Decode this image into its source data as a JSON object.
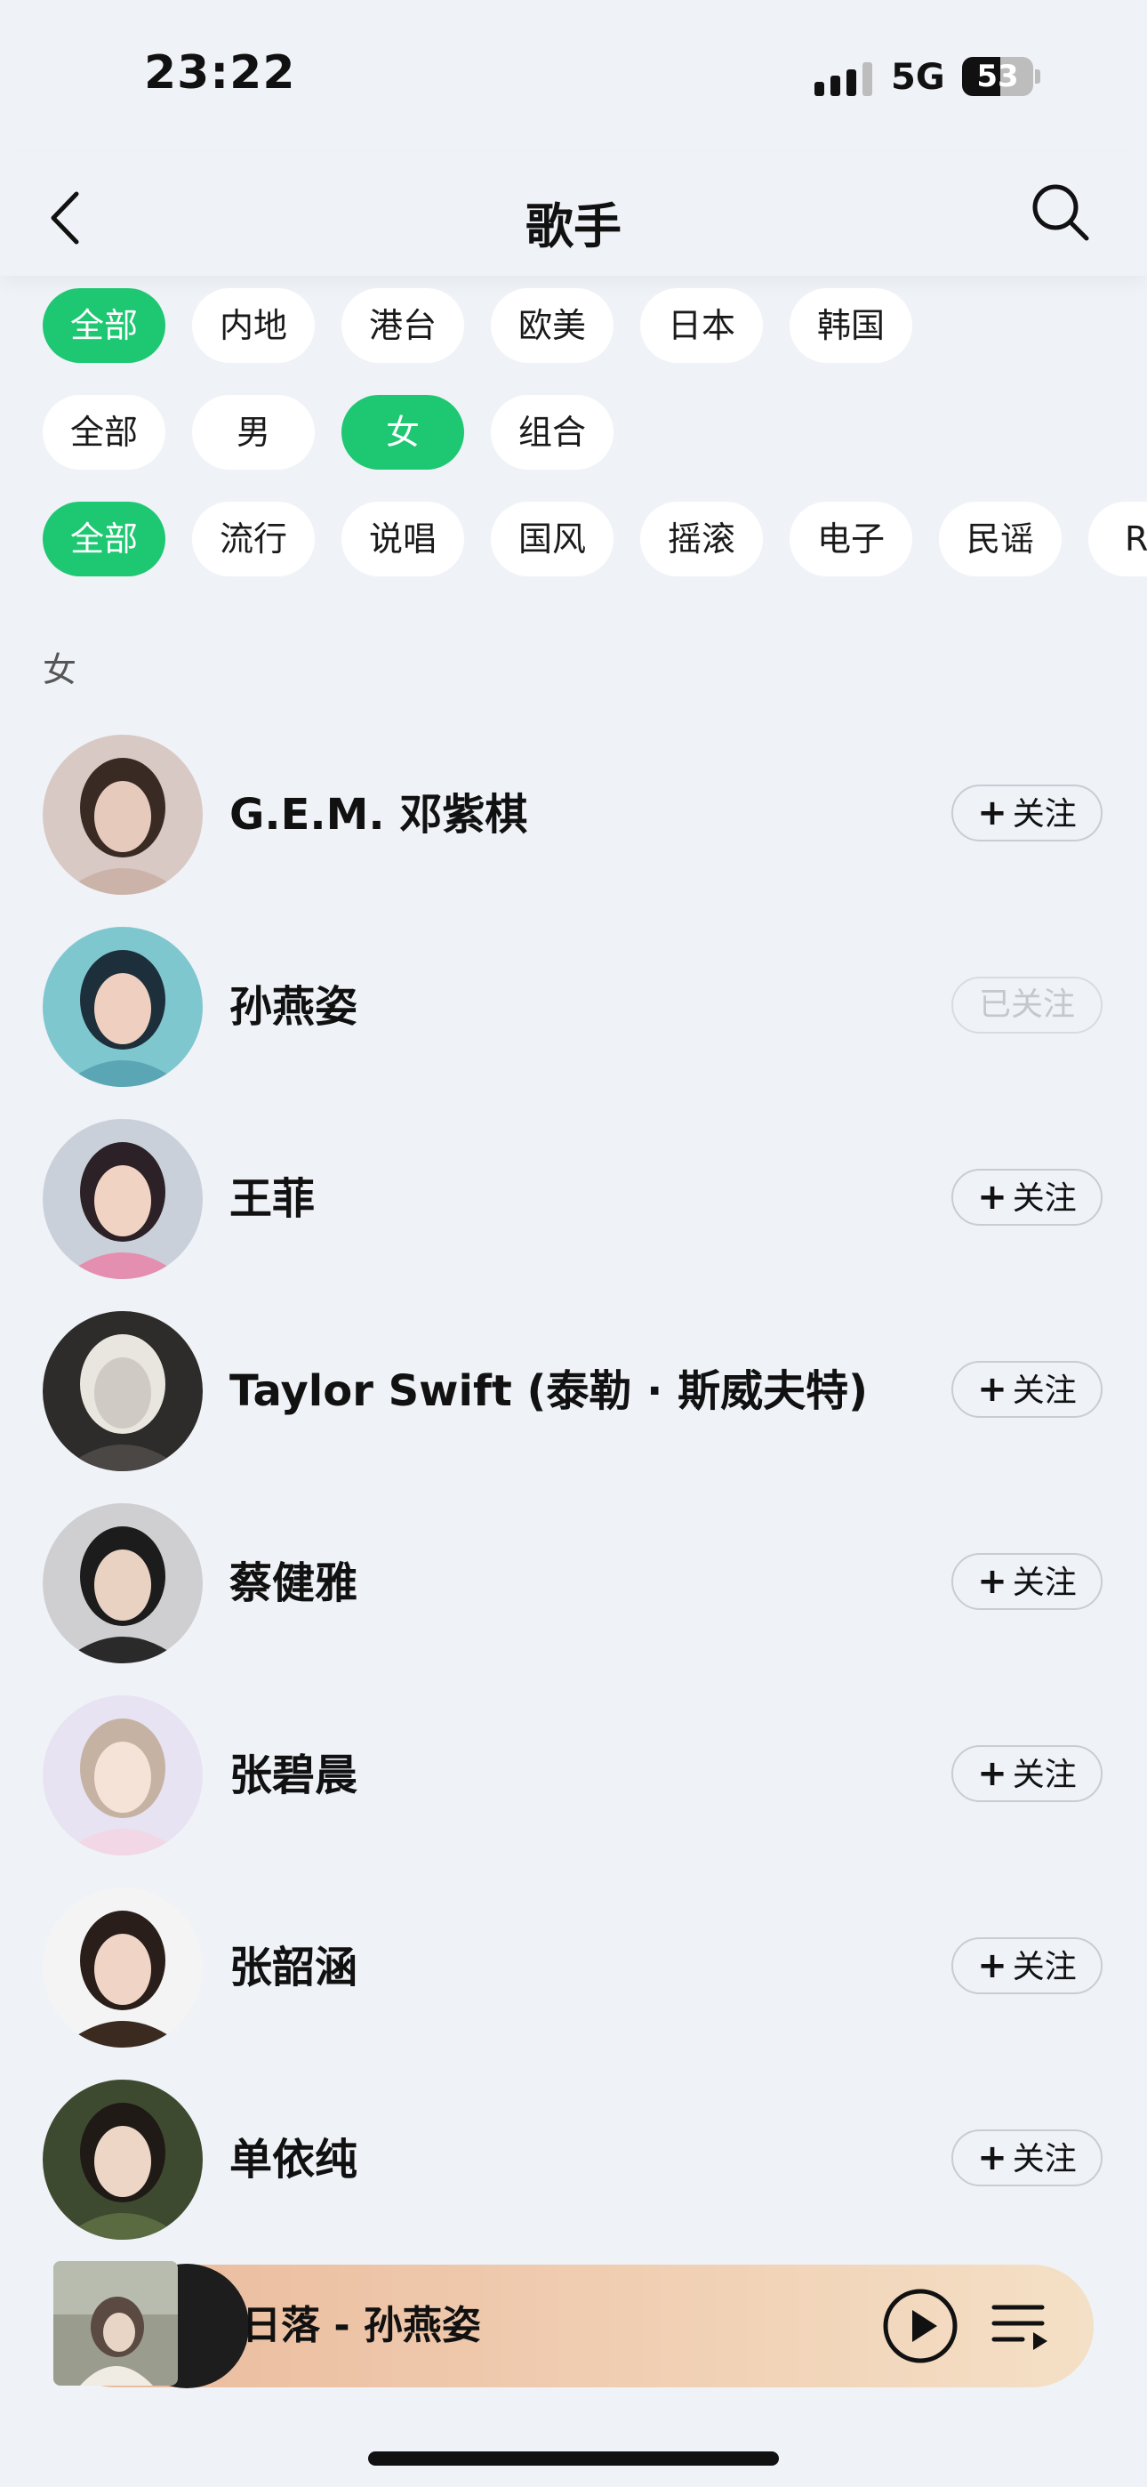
{
  "status_bar": {
    "time": "23:22",
    "network": "5G",
    "battery": "53"
  },
  "nav": {
    "title": "歌手",
    "back_icon": "chevron-left-icon",
    "search_icon": "search-icon"
  },
  "filters": {
    "region": [
      "全部",
      "内地",
      "港台",
      "欧美",
      "日本",
      "韩国"
    ],
    "region_selected": "全部",
    "gender": [
      "全部",
      "男",
      "女",
      "组合"
    ],
    "gender_selected": "女",
    "genre": [
      "全部",
      "流行",
      "说唱",
      "国风",
      "摇滚",
      "电子",
      "民谣",
      "R&"
    ],
    "genre_selected": "全部"
  },
  "section_label": "女",
  "artists": [
    {
      "name": "G.E.M. 邓紫棋",
      "button": "关注",
      "followed": false
    },
    {
      "name": "孙燕姿",
      "button": "已关注",
      "followed": true
    },
    {
      "name": "王菲",
      "button": "关注",
      "followed": false
    },
    {
      "name": "Taylor Swift (泰勒 · 斯威夫特)",
      "button": "关注",
      "followed": false
    },
    {
      "name": "蔡健雅",
      "button": "关注",
      "followed": false
    },
    {
      "name": "张碧晨",
      "button": "关注",
      "followed": false
    },
    {
      "name": "张韶涵",
      "button": "关注",
      "followed": false
    },
    {
      "name": "单依纯",
      "button": "关注",
      "followed": false
    }
  ],
  "player": {
    "track": "日落 - 孙燕姿",
    "play_icon": "play-icon",
    "playlist_icon": "playlist-icon"
  },
  "colors": {
    "accent": "#1ec771",
    "background": "#eff2f7"
  }
}
